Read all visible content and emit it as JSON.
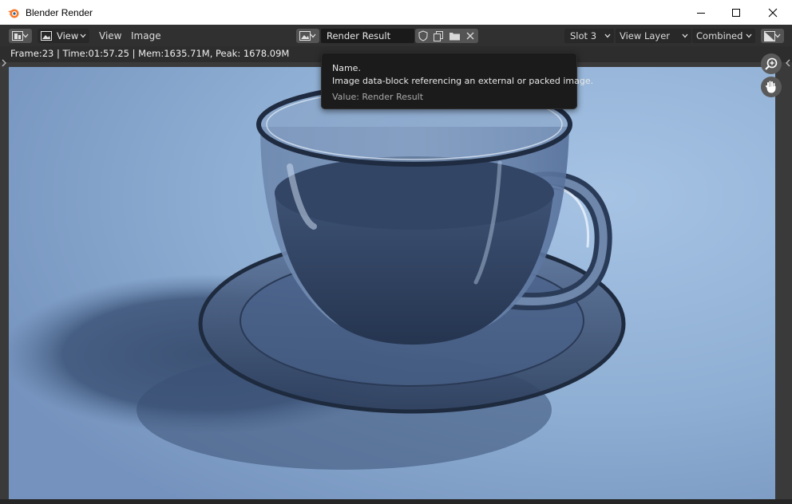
{
  "window": {
    "title": "Blender Render"
  },
  "header": {
    "editor_type_icon": "image-editor-icon",
    "view_mode_label": "View",
    "menus": [
      "View",
      "Image"
    ],
    "image_name": "Render Result",
    "slot": "Slot 3",
    "view_layer": "View Layer",
    "render_pass": "Combined"
  },
  "info": {
    "stats": "Frame:23 | Time:01:57.25 | Mem:1635.71M, Peak: 1678.09M"
  },
  "tooltip": {
    "heading": "Name.",
    "description": "Image data-block referencing an external or packed image.",
    "value": "Value: Render Result"
  },
  "colors": {
    "header_bg": "#303030",
    "field_bg": "#1d1d1d",
    "render_background": "#87a7cc",
    "cup_tint": "#3f5577"
  }
}
